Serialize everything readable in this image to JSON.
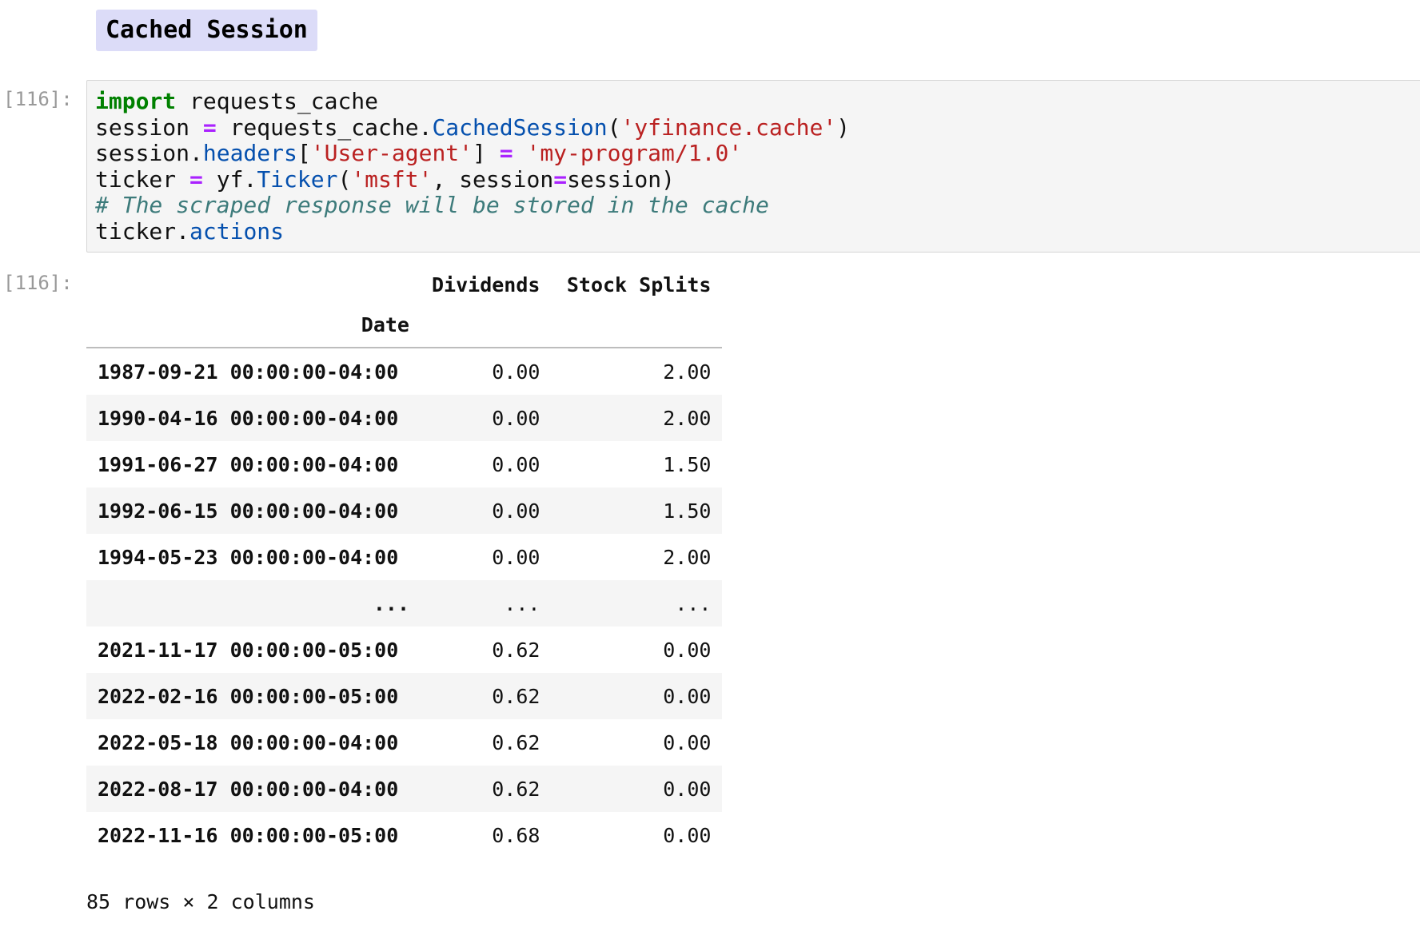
{
  "markdown_cell": {
    "heading": "Cached Session"
  },
  "code_cell": {
    "prompt_in": "[116]:",
    "prompt_out": "[116]:",
    "source_lines": [
      "import requests_cache",
      "session = requests_cache.CachedSession('yfinance.cache')",
      "session.headers['User-agent'] = 'my-program/1.0'",
      "ticker = yf.Ticker('msft', session=session)",
      "# The scraped response will be stored in the cache",
      "ticker.actions"
    ]
  },
  "output": {
    "columns": [
      "Dividends",
      "Stock Splits"
    ],
    "index_name": "Date",
    "rows": [
      {
        "date": "1987-09-21 00:00:00-04:00",
        "dividends": "0.00",
        "splits": "2.00"
      },
      {
        "date": "1990-04-16 00:00:00-04:00",
        "dividends": "0.00",
        "splits": "2.00"
      },
      {
        "date": "1991-06-27 00:00:00-04:00",
        "dividends": "0.00",
        "splits": "1.50"
      },
      {
        "date": "1992-06-15 00:00:00-04:00",
        "dividends": "0.00",
        "splits": "1.50"
      },
      {
        "date": "1994-05-23 00:00:00-04:00",
        "dividends": "0.00",
        "splits": "2.00"
      },
      {
        "date": "...",
        "dividends": "...",
        "splits": "..."
      },
      {
        "date": "2021-11-17 00:00:00-05:00",
        "dividends": "0.62",
        "splits": "0.00"
      },
      {
        "date": "2022-02-16 00:00:00-05:00",
        "dividends": "0.62",
        "splits": "0.00"
      },
      {
        "date": "2022-05-18 00:00:00-04:00",
        "dividends": "0.62",
        "splits": "0.00"
      },
      {
        "date": "2022-08-17 00:00:00-04:00",
        "dividends": "0.62",
        "splits": "0.00"
      },
      {
        "date": "2022-11-16 00:00:00-05:00",
        "dividends": "0.68",
        "splits": "0.00"
      }
    ],
    "shape_text": "85 rows × 2 columns"
  }
}
